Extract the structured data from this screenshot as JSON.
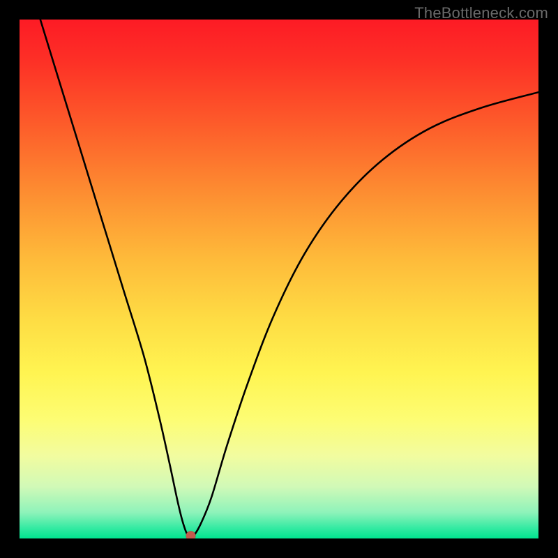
{
  "watermark": "TheBottleneck.com",
  "chart_data": {
    "type": "line",
    "title": "",
    "xlabel": "",
    "ylabel": "",
    "xlim": [
      0,
      100
    ],
    "ylim": [
      0,
      100
    ],
    "grid": false,
    "legend": false,
    "minimum_point": {
      "x": 32,
      "y": 0
    },
    "marker": {
      "x": 33,
      "y": 0.5,
      "color": "#c35a4d"
    },
    "series": [
      {
        "name": "bottleneck-curve",
        "color": "#000000",
        "x": [
          4,
          8,
          12,
          16,
          20,
          24,
          27,
          29,
          30.5,
          31.5,
          32.5,
          33.5,
          35,
          37,
          40,
          44,
          49,
          55,
          62,
          70,
          79,
          89,
          100
        ],
        "y": [
          100,
          87,
          74,
          61,
          48,
          35,
          23,
          14,
          7,
          3,
          0.5,
          0.5,
          3,
          8,
          18,
          30,
          43,
          55,
          65,
          73,
          79,
          83,
          86
        ]
      }
    ],
    "colors": {
      "gradient_top": "#fd1b25",
      "gradient_bottom": "#00e58f",
      "frame": "#000000"
    }
  }
}
